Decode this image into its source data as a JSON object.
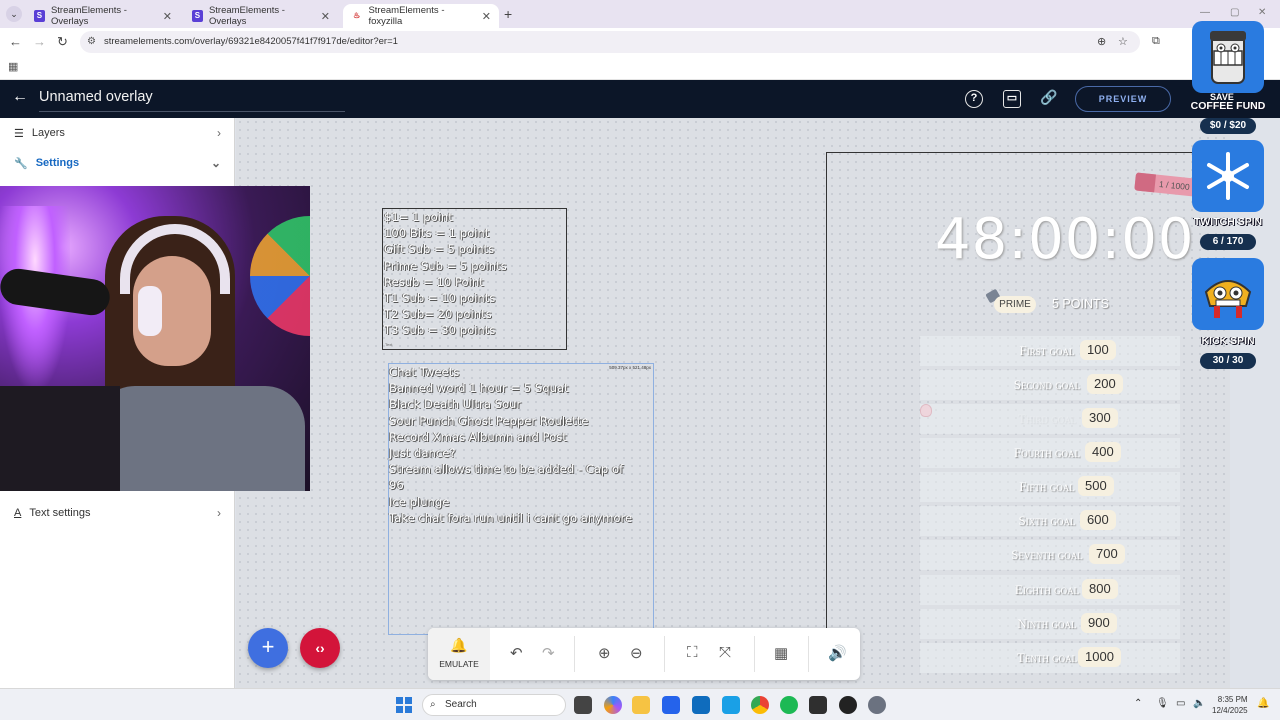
{
  "browser": {
    "tabs": [
      {
        "title": "StreamElements - Overlays",
        "active": false
      },
      {
        "title": "StreamElements - Overlays",
        "active": false
      },
      {
        "title": "StreamElements - foxyzilla",
        "active": true
      }
    ],
    "url": "streamelements.com/overlay/69321e8420057f41f7f917de/editor?er=1"
  },
  "header": {
    "title": "Unnamed overlay",
    "preview_label": "PREVIEW",
    "save_label": "SAVE"
  },
  "sidebar": {
    "layers_label": "Layers",
    "settings_label": "Settings",
    "text_settings_label": "Text settings"
  },
  "canvas": {
    "points_lines": [
      "$1= 1 point",
      "100 Bits = 1 point",
      "Gift Sub = 5 points",
      "Prime Sub = 5 points",
      "Resub = 10 Point",
      "T1 Sub = 10 points",
      "T2 Sub= 20 points",
      "T3 Sub = 30 points"
    ],
    "points_tag": "Text",
    "tweets_dims": "509.37px x 521.48px",
    "tweets_lines": [
      "Chat Tweets",
      "Banned word 1 hour = 5 Squat",
      "Black Death Ultra Sour",
      "Sour Punch Ghost Pepper Roulette",
      "Record Xmas Albumn and Post",
      "Just dance?",
      "Stream allows time to be added - Cap of",
      "96",
      "Ice plunge",
      "Take chat fora run until i cant go anymore"
    ],
    "timer": "48:00:00",
    "prime_label": "PRIME",
    "prime_points": "5 POINTS",
    "eraser_text": "1 / 1000",
    "goals": [
      {
        "label": "First goal",
        "value": "100",
        "faded": false
      },
      {
        "label": "Second goal",
        "value": "200",
        "faded": false
      },
      {
        "label": "Third goal",
        "value": "300",
        "faded": true
      },
      {
        "label": "Fourth goal",
        "value": "400",
        "faded": false
      },
      {
        "label": "Fifth goal",
        "value": "500",
        "faded": false
      },
      {
        "label": "Sixth goal",
        "value": "600",
        "faded": false
      },
      {
        "label": "Seventh goal",
        "value": "700",
        "faded": false
      },
      {
        "label": "Eighth goal",
        "value": "800",
        "faded": false
      },
      {
        "label": "Ninth goal",
        "value": "900",
        "faded": false
      },
      {
        "label": "Tenth goal",
        "value": "1000",
        "faded": false
      }
    ]
  },
  "widgets": {
    "coffee_title": "COFFEE FUND",
    "coffee_value": "$0 / $20",
    "twitch_title": "TWITCH SPIN",
    "twitch_value": "6 / 170",
    "kick_title": "KICK SPIN",
    "kick_value": "30 / 30"
  },
  "toolbar": {
    "emulate_label": "EMULATE"
  },
  "taskbar": {
    "search_placeholder": "Search",
    "time": "8:35 PM",
    "date": "12/4/2025"
  },
  "colors": {
    "header_bg": "#0c1628",
    "accent_blue": "#3f6fe0",
    "accent_red": "#d3143a",
    "settings_active": "#1769c2"
  }
}
